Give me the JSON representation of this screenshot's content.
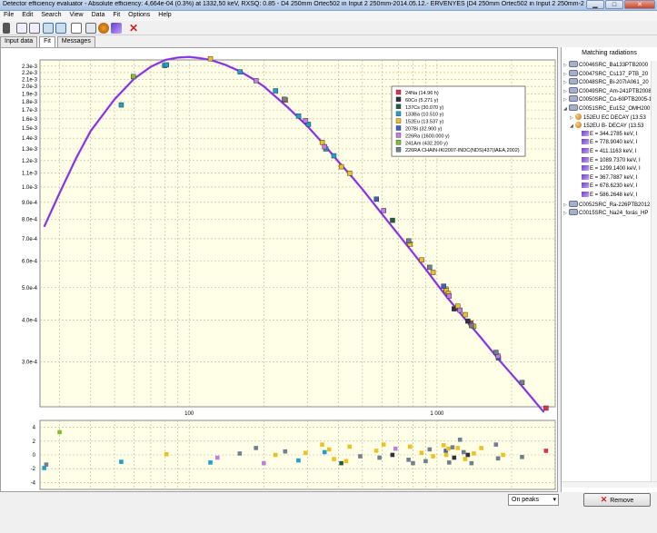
{
  "window": {
    "title": "Detector efficiency evaluator - Absolute efficiency: 4,664e-04 (0.3%) at 1332,50 keV, RXSQ: 0.85 - D4 250mm Ortec502 in Input 2 250mm-2014.05.12.- ÉRVÉNYES [D4 250mm Ortec502 in Input 2 250mm-2014.05.12.- ...",
    "minimize": "▁",
    "maximize": "□",
    "close": "✕"
  },
  "menu": [
    "File",
    "Edit",
    "Search",
    "View",
    "Data",
    "Fit",
    "Options",
    "Help"
  ],
  "tabs": [
    "Input data",
    "Fit",
    "Messages"
  ],
  "right_panel": {
    "title": "Matching radiations",
    "items": [
      {
        "label": "C0046SRC_Ba133PTB2000",
        "level": 0
      },
      {
        "label": "C0047SRC_Cs137_PTB_20",
        "level": 0
      },
      {
        "label": "C0048SRC_Bi-207IA061_20",
        "level": 0
      },
      {
        "label": "C0049SRC_Am-241PTB2008",
        "level": 0
      },
      {
        "label": "C0050SRC_Co-60PTB2005-1",
        "level": 0
      },
      {
        "label": "C0051SRC_Eu152_OMH200",
        "level": 0
      },
      {
        "label": "152EU EC DECAY (13.53",
        "level": 1
      },
      {
        "label": "152EU B- DECAY (13.53",
        "level": 1
      },
      {
        "label": "E = 344.2785 keV, I",
        "level": 2
      },
      {
        "label": "E = 778.9040 keV, I",
        "level": 2
      },
      {
        "label": "E = 411.1163 keV, I",
        "level": 2
      },
      {
        "label": "E = 1089.7370 keV, I",
        "level": 2
      },
      {
        "label": "E = 1299.1400 keV, I",
        "level": 2
      },
      {
        "label": "E = 367.7887 keV, I",
        "level": 2
      },
      {
        "label": "E = 678.6230 keV, I",
        "level": 2
      },
      {
        "label": "E = 586.2648 keV, I",
        "level": 2
      },
      {
        "label": "C0052SRC_Ra-226PTB2012",
        "level": 0
      },
      {
        "label": "C0015SRC_Na24_forás_HP",
        "level": 0
      }
    ]
  },
  "bottom": {
    "combo_value": "On peaks",
    "remove_label": "Remove"
  },
  "chart_data": [
    {
      "type": "scatter",
      "title": "",
      "xscale": "log",
      "yscale": "log",
      "xlim": [
        25,
        3000
      ],
      "ylim": [
        0.00022,
        0.0024
      ],
      "x_ticks": [
        100,
        1000
      ],
      "x_tick_labels": [
        "100",
        "1 000"
      ],
      "y_ticks": [
        0.0023,
        0.0022,
        0.0021,
        0.002,
        0.0019,
        0.0018,
        0.0017,
        0.0016,
        0.0015,
        0.0014,
        0.0013,
        0.0012,
        0.0011,
        0.001,
        0.0009,
        0.0008,
        0.0007,
        0.0006,
        0.0005,
        0.0004,
        0.0003
      ],
      "y_tick_labels": [
        "2.3e-3",
        "2.2e-3",
        "2.1e-3",
        "2.0e-3",
        "1.9e-3",
        "1.8e-3",
        "1.7e-3",
        "1.6e-3",
        "1.5e-3",
        "1.4e-3",
        "1.3e-3",
        "1.2e-3",
        "1.1e-3",
        "1.0e-3",
        "9.0e-4",
        "8.0e-4",
        "7.0e-4",
        "6.0e-4",
        "5.0e-4",
        "4.0e-4",
        "3.0e-4"
      ],
      "grid": true,
      "legend_position": "top-right",
      "fit_curve": {
        "color_outer": "#d040d0",
        "color_inner": "#4040ff",
        "x": [
          26,
          30,
          35,
          40,
          50,
          60,
          70,
          80,
          90,
          100,
          110,
          122,
          140,
          160,
          180,
          200,
          250,
          300,
          350,
          400,
          450,
          500,
          600,
          700,
          800,
          900,
          1000,
          1100,
          1200,
          1300,
          1500,
          1800,
          2200,
          2700
        ],
        "y": [
          0.00076,
          0.00096,
          0.00122,
          0.00147,
          0.00183,
          0.00211,
          0.00229,
          0.0024,
          0.00244,
          0.00245,
          0.00243,
          0.0024,
          0.00232,
          0.00222,
          0.00211,
          0.002,
          0.00173,
          0.00152,
          0.00134,
          0.00119,
          0.00108,
          0.000985,
          0.00083,
          0.00072,
          0.000635,
          0.000568,
          0.000512,
          0.000467,
          0.000432,
          0.000402,
          0.000355,
          0.000301,
          0.000254,
          0.000212
        ]
      },
      "series": [
        {
          "name": "24Na (14.96 h)",
          "color": "#e03050",
          "points": [
            [
              1368.6,
              0.000392
            ],
            [
              2754.0,
              0.000218
            ]
          ]
        },
        {
          "name": "60Co (5.271 y)",
          "color": "#303040",
          "points": [
            [
              1173.2,
              0.000432
            ],
            [
              1332.5,
              0.000397
            ]
          ]
        },
        {
          "name": "137Cs (30.070 y)",
          "color": "#206040",
          "points": [
            [
              661.7,
              0.000795
            ]
          ]
        },
        {
          "name": "133Ba (10.510 y)",
          "color": "#20a0d0",
          "points": [
            [
              53.2,
              0.00176
            ],
            [
              79.6,
              0.00231
            ],
            [
              81.0,
              0.00232
            ],
            [
              160.6,
              0.00221
            ],
            [
              223.2,
              0.00194
            ],
            [
              276.4,
              0.00163
            ],
            [
              302.9,
              0.00154
            ],
            [
              356.0,
              0.0013
            ],
            [
              383.8,
              0.00124
            ]
          ]
        },
        {
          "name": "152Eu (13.537 y)",
          "color": "#f0c020",
          "points": [
            [
              121.8,
              0.00242
            ],
            [
              244.7,
              0.00182
            ],
            [
              344.3,
              0.00136
            ],
            [
              411.1,
              0.00115
            ],
            [
              444.0,
              0.0011
            ],
            [
              778.9,
              0.000675
            ],
            [
              867.4,
              0.000605
            ],
            [
              964.1,
              0.000555
            ],
            [
              1085.8,
              0.000495
            ],
            [
              1089.7,
              0.00049
            ],
            [
              1112.1,
              0.00048
            ],
            [
              1212.9,
              0.00044
            ],
            [
              1299.1,
              0.000415
            ],
            [
              1408.0,
              0.000383
            ]
          ]
        },
        {
          "name": "207Bi (32.900 y)",
          "color": "#4060c0",
          "points": [
            [
              569.7,
              0.00092
            ],
            [
              1063.7,
              0.000505
            ],
            [
              1770.2,
              0.000308
            ]
          ]
        },
        {
          "name": "226Ra (1600.000 y)",
          "color": "#c080e0",
          "points": [
            [
              186.2,
              0.00208
            ],
            [
              295.2,
              0.00158
            ],
            [
              351.9,
              0.00132
            ],
            [
              609.3,
              0.00085
            ],
            [
              1120.3,
              0.000472
            ],
            [
              1238.1,
              0.000428
            ],
            [
              1764.5,
              0.000312
            ]
          ]
        },
        {
          "name": "241Am (432.200 y)",
          "color": "#80c030",
          "points": [
            [
              59.5,
              0.00214
            ]
          ]
        },
        {
          "name": "226RA CHAIN-IKI2007-INDC(NDS)437(IAEA,2002)",
          "color": "#708090",
          "points": [
            [
              242.0,
              0.00183
            ],
            [
              768.4,
              0.00069
            ],
            [
              934.1,
              0.000575
            ],
            [
              1377.7,
              0.000385
            ],
            [
              1729.6,
              0.00032
            ],
            [
              2204.1,
              0.00026
            ]
          ]
        }
      ]
    },
    {
      "type": "scatter",
      "title": "",
      "xscale": "log",
      "xlim": [
        25,
        3000
      ],
      "ylim": [
        -5,
        5
      ],
      "y_ticks": [
        4,
        2,
        0,
        -2,
        -4
      ],
      "y_tick_labels": [
        "4",
        "2",
        "0",
        "-2",
        "-4"
      ],
      "grid": true,
      "points": [
        {
          "x": 26,
          "y": -1.9,
          "c": "#20a0d0"
        },
        {
          "x": 26.5,
          "y": -1.4,
          "c": "#708090"
        },
        {
          "x": 30,
          "y": 3.3,
          "c": "#80c030"
        },
        {
          "x": 53.2,
          "y": -1.0,
          "c": "#20a0d0"
        },
        {
          "x": 81,
          "y": 0.1,
          "c": "#f0c020"
        },
        {
          "x": 121.8,
          "y": -1.1,
          "c": "#20a0d0"
        },
        {
          "x": 130,
          "y": -0.4,
          "c": "#c080e0"
        },
        {
          "x": 160,
          "y": 0.2,
          "c": "#708090"
        },
        {
          "x": 186,
          "y": 1.0,
          "c": "#708090"
        },
        {
          "x": 200,
          "y": -1.2,
          "c": "#c080e0"
        },
        {
          "x": 223,
          "y": 0.0,
          "c": "#f0c020"
        },
        {
          "x": 244,
          "y": 0.5,
          "c": "#708090"
        },
        {
          "x": 276,
          "y": -0.8,
          "c": "#20a0d0"
        },
        {
          "x": 295,
          "y": 0.3,
          "c": "#f0c020"
        },
        {
          "x": 344,
          "y": 1.5,
          "c": "#f0c020"
        },
        {
          "x": 352,
          "y": 0.4,
          "c": "#20a0d0"
        },
        {
          "x": 367,
          "y": 0.8,
          "c": "#f0c020"
        },
        {
          "x": 384,
          "y": -0.6,
          "c": "#f0c020"
        },
        {
          "x": 411,
          "y": -1.2,
          "c": "#206040"
        },
        {
          "x": 430,
          "y": -0.9,
          "c": "#f0c020"
        },
        {
          "x": 444,
          "y": 1.2,
          "c": "#f0c020"
        },
        {
          "x": 490,
          "y": -0.2,
          "c": "#708090"
        },
        {
          "x": 569,
          "y": 0.6,
          "c": "#f0c020"
        },
        {
          "x": 586,
          "y": -0.4,
          "c": "#708090"
        },
        {
          "x": 609,
          "y": 1.5,
          "c": "#f0c020"
        },
        {
          "x": 661,
          "y": 0.0,
          "c": "#303040"
        },
        {
          "x": 680,
          "y": 0.9,
          "c": "#c080e0"
        },
        {
          "x": 768,
          "y": -0.7,
          "c": "#708090"
        },
        {
          "x": 779,
          "y": 1.2,
          "c": "#f0c020"
        },
        {
          "x": 800,
          "y": -1.2,
          "c": "#708090"
        },
        {
          "x": 867,
          "y": 0.3,
          "c": "#f0c020"
        },
        {
          "x": 900,
          "y": -0.9,
          "c": "#708090"
        },
        {
          "x": 934,
          "y": 0.8,
          "c": "#708090"
        },
        {
          "x": 964,
          "y": -0.2,
          "c": "#f0c020"
        },
        {
          "x": 1063,
          "y": 1.4,
          "c": "#f0c020"
        },
        {
          "x": 1086,
          "y": 0.6,
          "c": "#4060c0"
        },
        {
          "x": 1090,
          "y": 0.0,
          "c": "#f0c020"
        },
        {
          "x": 1112,
          "y": 0.9,
          "c": "#f0c020"
        },
        {
          "x": 1120,
          "y": -1.1,
          "c": "#708090"
        },
        {
          "x": 1155,
          "y": 1.1,
          "c": "#708090"
        },
        {
          "x": 1173,
          "y": -0.4,
          "c": "#303040"
        },
        {
          "x": 1213,
          "y": 1.0,
          "c": "#f0c020"
        },
        {
          "x": 1238,
          "y": 2.2,
          "c": "#708090"
        },
        {
          "x": 1281,
          "y": 0.4,
          "c": "#708090"
        },
        {
          "x": 1299,
          "y": -0.6,
          "c": "#f0c020"
        },
        {
          "x": 1332,
          "y": 0.0,
          "c": "#303040"
        },
        {
          "x": 1378,
          "y": -1.2,
          "c": "#708090"
        },
        {
          "x": 1408,
          "y": 0.2,
          "c": "#f0c020"
        },
        {
          "x": 1509,
          "y": 1.0,
          "c": "#f0c020"
        },
        {
          "x": 1730,
          "y": 1.5,
          "c": "#708090"
        },
        {
          "x": 1764,
          "y": -0.5,
          "c": "#708090"
        },
        {
          "x": 1847,
          "y": 0.0,
          "c": "#f0c020"
        },
        {
          "x": 2204,
          "y": -0.3,
          "c": "#708090"
        },
        {
          "x": 2754,
          "y": 0.6,
          "c": "#e03050"
        }
      ]
    }
  ]
}
